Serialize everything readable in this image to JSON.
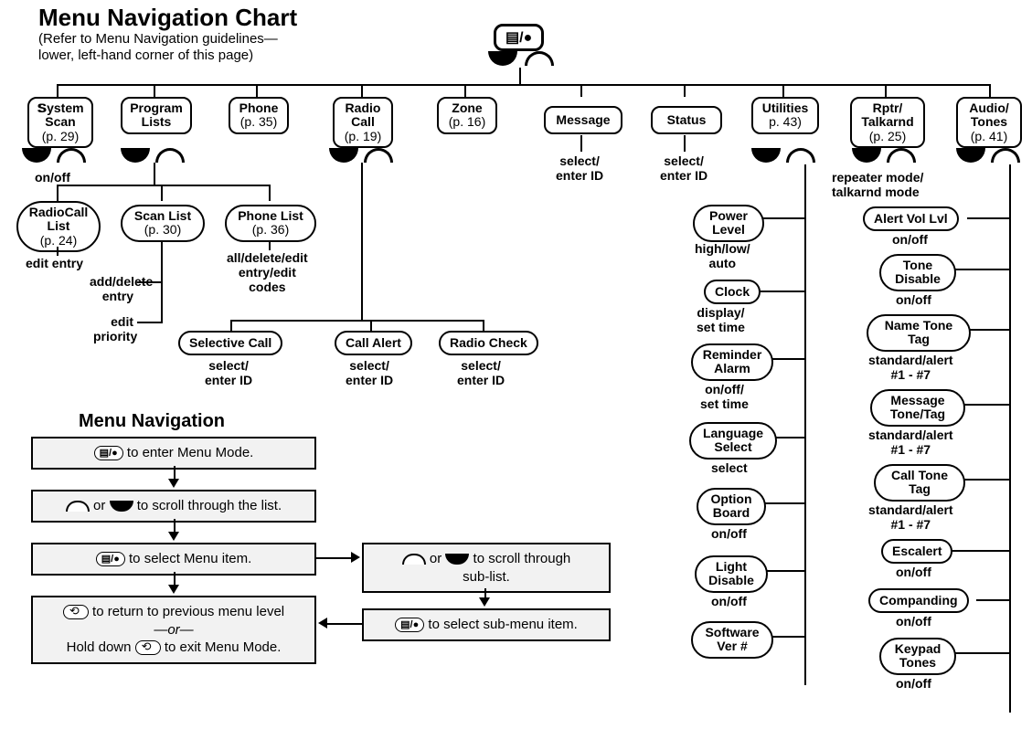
{
  "header": {
    "title": "Menu Navigation Chart",
    "subtitle_line1": "(Refer to Menu Navigation guidelines—",
    "subtitle_line2": "lower, left-hand corner of this page)"
  },
  "root_button": "▤/●",
  "top_menus": [
    {
      "l1": "System",
      "l2": "Scan",
      "page": "(p. 29)"
    },
    {
      "l1": "Program",
      "l2": "Lists",
      "page": ""
    },
    {
      "l1": "Phone",
      "l2": "",
      "page": "(p. 35)"
    },
    {
      "l1": "Radio",
      "l2": "Call",
      "page": "(p. 19)"
    },
    {
      "l1": "Zone",
      "l2": "",
      "page": "(p. 16)"
    },
    {
      "l1": "Message",
      "l2": "",
      "page": ""
    },
    {
      "l1": "Status",
      "l2": "",
      "page": ""
    },
    {
      "l1": "Utilities",
      "l2": "",
      "page": "p. 43)"
    },
    {
      "l1": "Rptr/",
      "l2": "Talkarnd",
      "page": "(p. 25)"
    },
    {
      "l1": "Audio/",
      "l2": "Tones",
      "page": "(p. 41)"
    }
  ],
  "labels": {
    "system_scan_onoff": "on/off",
    "message_action": "select/\nenter ID",
    "status_action": "select/\nenter ID",
    "rptr_mode": "repeater mode/\ntalkarnd mode"
  },
  "program_lists": {
    "radiocall": {
      "l1": "RadioCall",
      "l2": "List",
      "page": "(p. 24)",
      "action": "edit entry"
    },
    "scanlist": {
      "l1": "Scan List",
      "page": "(p. 30)",
      "action1": "add/delete\nentry",
      "action2": "edit\npriority"
    },
    "phonelist": {
      "l1": "Phone List",
      "page": "(p. 36)",
      "action": "all/delete/edit\nentry/edit\ncodes"
    }
  },
  "radio_call_children": [
    {
      "name": "Selective Call",
      "action": "select/\nenter ID"
    },
    {
      "name": "Call Alert",
      "action": "select/\nenter ID"
    },
    {
      "name": "Radio Check",
      "action": "select/\nenter ID"
    }
  ],
  "utilities": [
    {
      "name": "Power\nLevel",
      "action": "high/low/\nauto"
    },
    {
      "name": "Clock",
      "action": "display/\nset time"
    },
    {
      "name": "Reminder\nAlarm",
      "action": "on/off/\nset time"
    },
    {
      "name": "Language\nSelect",
      "action": "select"
    },
    {
      "name": "Option\nBoard",
      "action": "on/off"
    },
    {
      "name": "Light\nDisable",
      "action": "on/off"
    },
    {
      "name": "Software\nVer #",
      "action": ""
    }
  ],
  "audio_tones": [
    {
      "name": "Alert Vol Lvl",
      "action": "on/off"
    },
    {
      "name": "Tone\nDisable",
      "action": "on/off"
    },
    {
      "name": "Name Tone\nTag",
      "action": "standard/alert\n#1 - #7"
    },
    {
      "name": "Message\nTone/Tag",
      "action": "standard/alert\n#1 - #7"
    },
    {
      "name": "Call Tone\nTag",
      "action": "standard/alert\n#1 - #7"
    },
    {
      "name": "Escalert",
      "action": "on/off"
    },
    {
      "name": "Companding",
      "action": "on/off"
    },
    {
      "name": "Keypad\nTones",
      "action": "on/off"
    }
  ],
  "nav_section": {
    "title": "Menu Navigation",
    "step1": " to enter Menu Mode.",
    "step2_mid": " or ",
    "step2_end": "   to scroll through the list.",
    "step3": " to select Menu item.",
    "step4_l1a": " to return to previous menu level",
    "step4_l2": "—or—",
    "step4_l3a": "Hold down ",
    "step4_l3b": " to exit Menu Mode.",
    "sub1_mid": " or ",
    "sub1_end": "   to scroll through",
    "sub1_l2": "sub-list.",
    "sub2": " to select sub-menu item."
  }
}
